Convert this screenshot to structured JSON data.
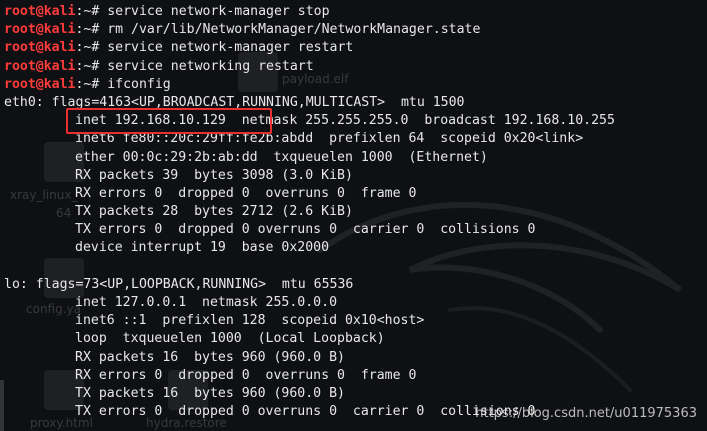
{
  "prompt": {
    "user_host": "root@kali",
    "path": ":~# "
  },
  "commands": [
    "service network-manager stop",
    "rm /var/lib/NetworkManager/NetworkManager.state",
    "service network-manager restart",
    "service networking restart",
    "ifconfig"
  ],
  "output": {
    "eth0_header": "eth0: flags=4163<UP,BROADCAST,RUNNING,MULTICAST>  mtu 1500",
    "eth0_lines": [
      "inet 192.168.10.129  netmask 255.255.255.0  broadcast 192.168.10.255",
      "inet6 fe80::20c:29ff:fe2b:abdd  prefixlen 64  scopeid 0x20<link>",
      "ether 00:0c:29:2b:ab:dd  txqueuelen 1000  (Ethernet)",
      "RX packets 39  bytes 3098 (3.0 KiB)",
      "RX errors 0  dropped 0  overruns 0  frame 0",
      "TX packets 28  bytes 2712 (2.6 KiB)",
      "TX errors 0  dropped 0 overruns 0  carrier 0  collisions 0",
      "device interrupt 19  base 0x2000"
    ],
    "lo_header": "lo: flags=73<UP,LOOPBACK,RUNNING>  mtu 65536",
    "lo_lines": [
      "inet 127.0.0.1  netmask 255.0.0.0",
      "inet6 ::1  prefixlen 128  scopeid 0x10<host>",
      "loop  txqueuelen 1000  (Local Loopback)",
      "RX packets 16  bytes 960 (960.0 B)",
      "RX errors 0  dropped 0  overruns 0  frame 0",
      "TX packets 16  bytes 960 (960.0 B)",
      "TX errors 0  dropped 0 overruns 0  carrier 0  collisions 0"
    ]
  },
  "desktop_labels": {
    "payload": "payload.elf",
    "xray": "xray_linux_",
    "xray_suffix": "64",
    "config": "config.ya",
    "proxy": "proxy.html",
    "hydra": "hydra.restore"
  },
  "watermark": "https://blog.csdn.net/u011975363",
  "colors": {
    "prompt_user": "#ff3b3b",
    "text": "#e8e8e8",
    "background": "#0f1013",
    "highlight_box": "#e8302c"
  }
}
